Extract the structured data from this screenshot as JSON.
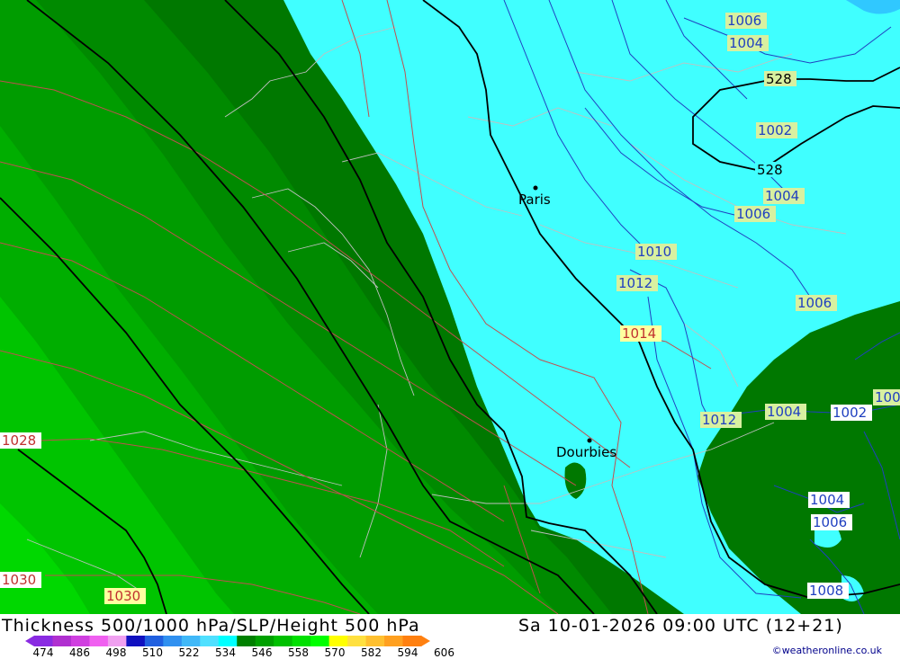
{
  "header": {
    "title": "Thickness 500/1000 hPa/SLP/Height 500 hPa",
    "datetime": "Sa 10-01-2026 09:00 UTC (12+21)",
    "credit": "©weatheronline.co.uk"
  },
  "cities": [
    {
      "name": "Paris"
    },
    {
      "name": "Dourbies"
    }
  ],
  "pressure_labels": [
    "1006",
    "1004",
    "1002",
    "1004",
    "1006",
    "1010",
    "1012",
    "1014",
    "1006",
    "1012",
    "1004",
    "1002",
    "1004",
    "1006",
    "1008",
    "1028",
    "1030",
    "1030",
    "100"
  ],
  "height_labels": [
    "528",
    "528"
  ],
  "legend": {
    "ticks": [
      "474",
      "486",
      "498",
      "510",
      "522",
      "534",
      "546",
      "558",
      "570",
      "582",
      "594",
      "606"
    ],
    "colors": [
      "#8a2be2",
      "#b030d0",
      "#d040e0",
      "#f060f0",
      "#f0a0f0",
      "#1010c0",
      "#2060e0",
      "#3090f0",
      "#40b8f8",
      "#50e0ff",
      "#00ffff",
      "#008000",
      "#00a000",
      "#00c000",
      "#00e000",
      "#00ff00",
      "#ffff00",
      "#ffe040",
      "#ffc030",
      "#ffa020",
      "#ff8010"
    ]
  },
  "colors": {
    "cyan": "#40ffff",
    "dark_green": "#007800",
    "mid_green": "#009000",
    "green": "#00a800",
    "light_green": "#00c000",
    "bright_green": "#00d800"
  }
}
